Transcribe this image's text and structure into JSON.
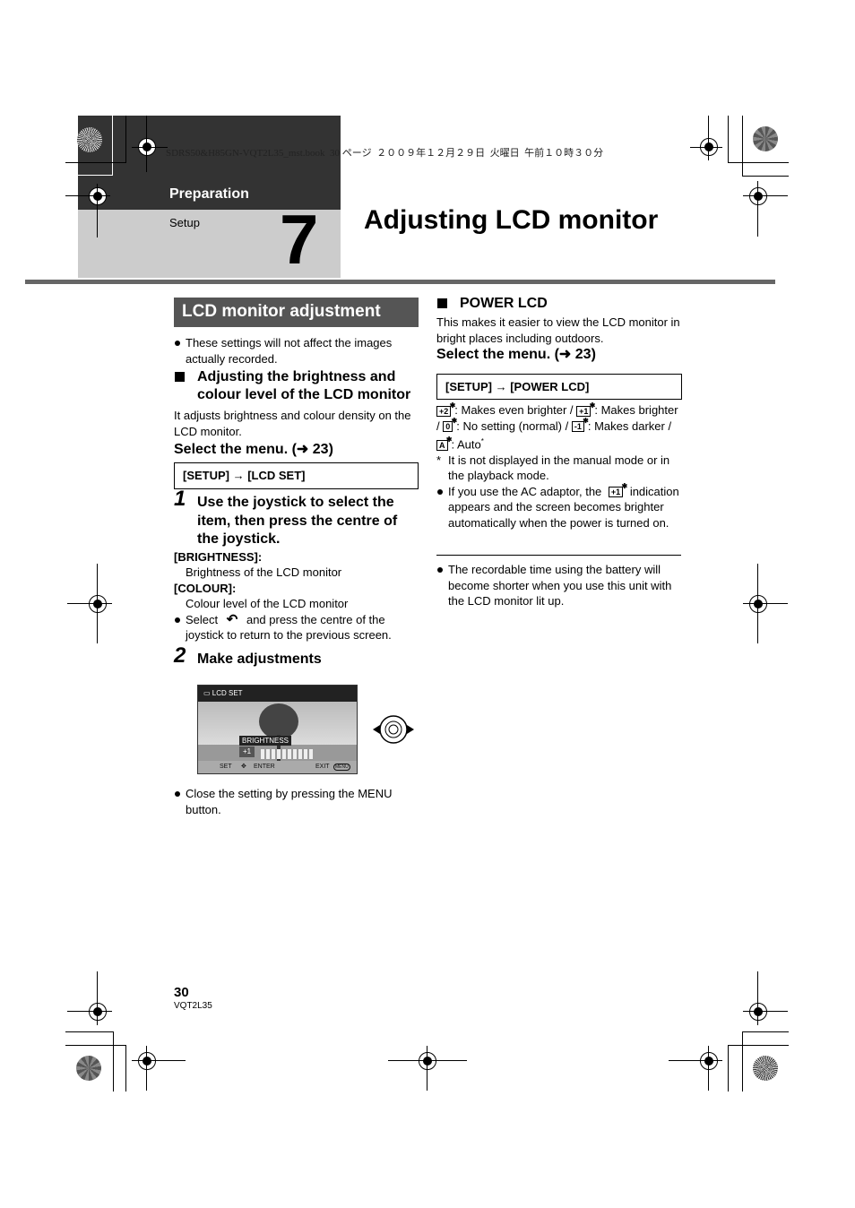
{
  "header": {
    "book_info": "SDRS50&H85GN-VQT2L35_mst.book  30 ページ  ２００９年１２月２９日  火曜日  午前１０時３０分",
    "section": "Preparation",
    "subsection": "Setup",
    "chapter_number": "7",
    "title": "Adjusting LCD monitor"
  },
  "left": {
    "box_title": "LCD monitor adjustment",
    "note1": "These settings will not affect the images actually recorded.",
    "heading": "Adjusting the brightness and colour level of the LCD monitor",
    "desc": "It adjusts brightness and colour density on the LCD monitor.",
    "select_menu": "Select the menu. (➜ 23)",
    "menu_path": "[SETUP] → [LCD SET]",
    "step1_num": "1",
    "step1": "Use the joystick to select the item, then press the centre of the joystick.",
    "item1_label": "[BRIGHTNESS]:",
    "item1_desc": "Brightness of the LCD monitor",
    "item2_label": "[COLOUR]:",
    "item2_desc": "Colour level of the LCD monitor",
    "return_note_pre": "Select",
    "return_icon": "↶",
    "return_note_post": "and press the centre of the joystick to return to the previous screen.",
    "step2_num": "2",
    "step2": "Make adjustments",
    "lcd": {
      "title": "LCD SET",
      "label": "BRIGHTNESS",
      "value": "+1",
      "set": "SET",
      "enter": "ENTER",
      "exit": "EXIT",
      "menu": "MENU"
    },
    "close_note": "Close the setting by pressing the MENU button."
  },
  "right": {
    "heading": "POWER LCD",
    "desc": "This makes it easier to view the LCD monitor in bright places including outdoors.",
    "select_menu": "Select the menu. (➜ 23)",
    "menu_path": "[SETUP] → [POWER LCD]",
    "options": [
      {
        "icon": "+2",
        "text": ": Makes even brighter / "
      },
      {
        "icon": "+1",
        "text": ": Makes brighter / "
      },
      {
        "icon": "0",
        "text": ": No setting (normal) / "
      },
      {
        "icon": "-1",
        "text": ": Makes darker / "
      },
      {
        "icon": "A",
        "text": ": Auto"
      }
    ],
    "footnote_mark": "*",
    "footnote": "It is not displayed in the manual mode or in the playback mode.",
    "ac_note_pre": "If you use the AC adaptor, the",
    "ac_icon": "+1",
    "ac_note_post": "indication appears and the screen becomes brighter automatically when the power is turned on.",
    "battery_note": "The recordable time using the battery will become shorter when you use this unit with the LCD monitor lit up."
  },
  "footer": {
    "page_number": "30",
    "code": "VQT2L35"
  }
}
